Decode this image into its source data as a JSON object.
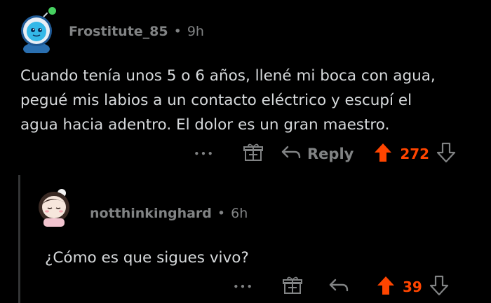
{
  "colors": {
    "background": "#000000",
    "text": "#d7dadc",
    "meta": "#818384",
    "upvote": "#ff4500",
    "online": "#46d160",
    "thread_line": "#343536"
  },
  "comments": [
    {
      "username": "Frostitute_85",
      "separator": "•",
      "time": "9h",
      "avatar_icon": "snoo-astronaut-avatar",
      "body_lines": [
        "Cuando tenía unos 5 o 6 años, llené mi boca con agua,",
        "pegué mis labios a un contacto eléctrico y escupí el",
        "agua hacia adentro. El dolor es un gran maestro."
      ],
      "more_label": "•••",
      "reply_label": "Reply",
      "score": "272",
      "upvoted": true
    },
    {
      "username": "notthinkinghard",
      "separator": "•",
      "time": "6h",
      "avatar_icon": "girl-avatar",
      "body_lines": [
        "¿Cómo es que sigues vivo?"
      ],
      "more_label": "•••",
      "score": "39",
      "upvoted": true
    }
  ]
}
